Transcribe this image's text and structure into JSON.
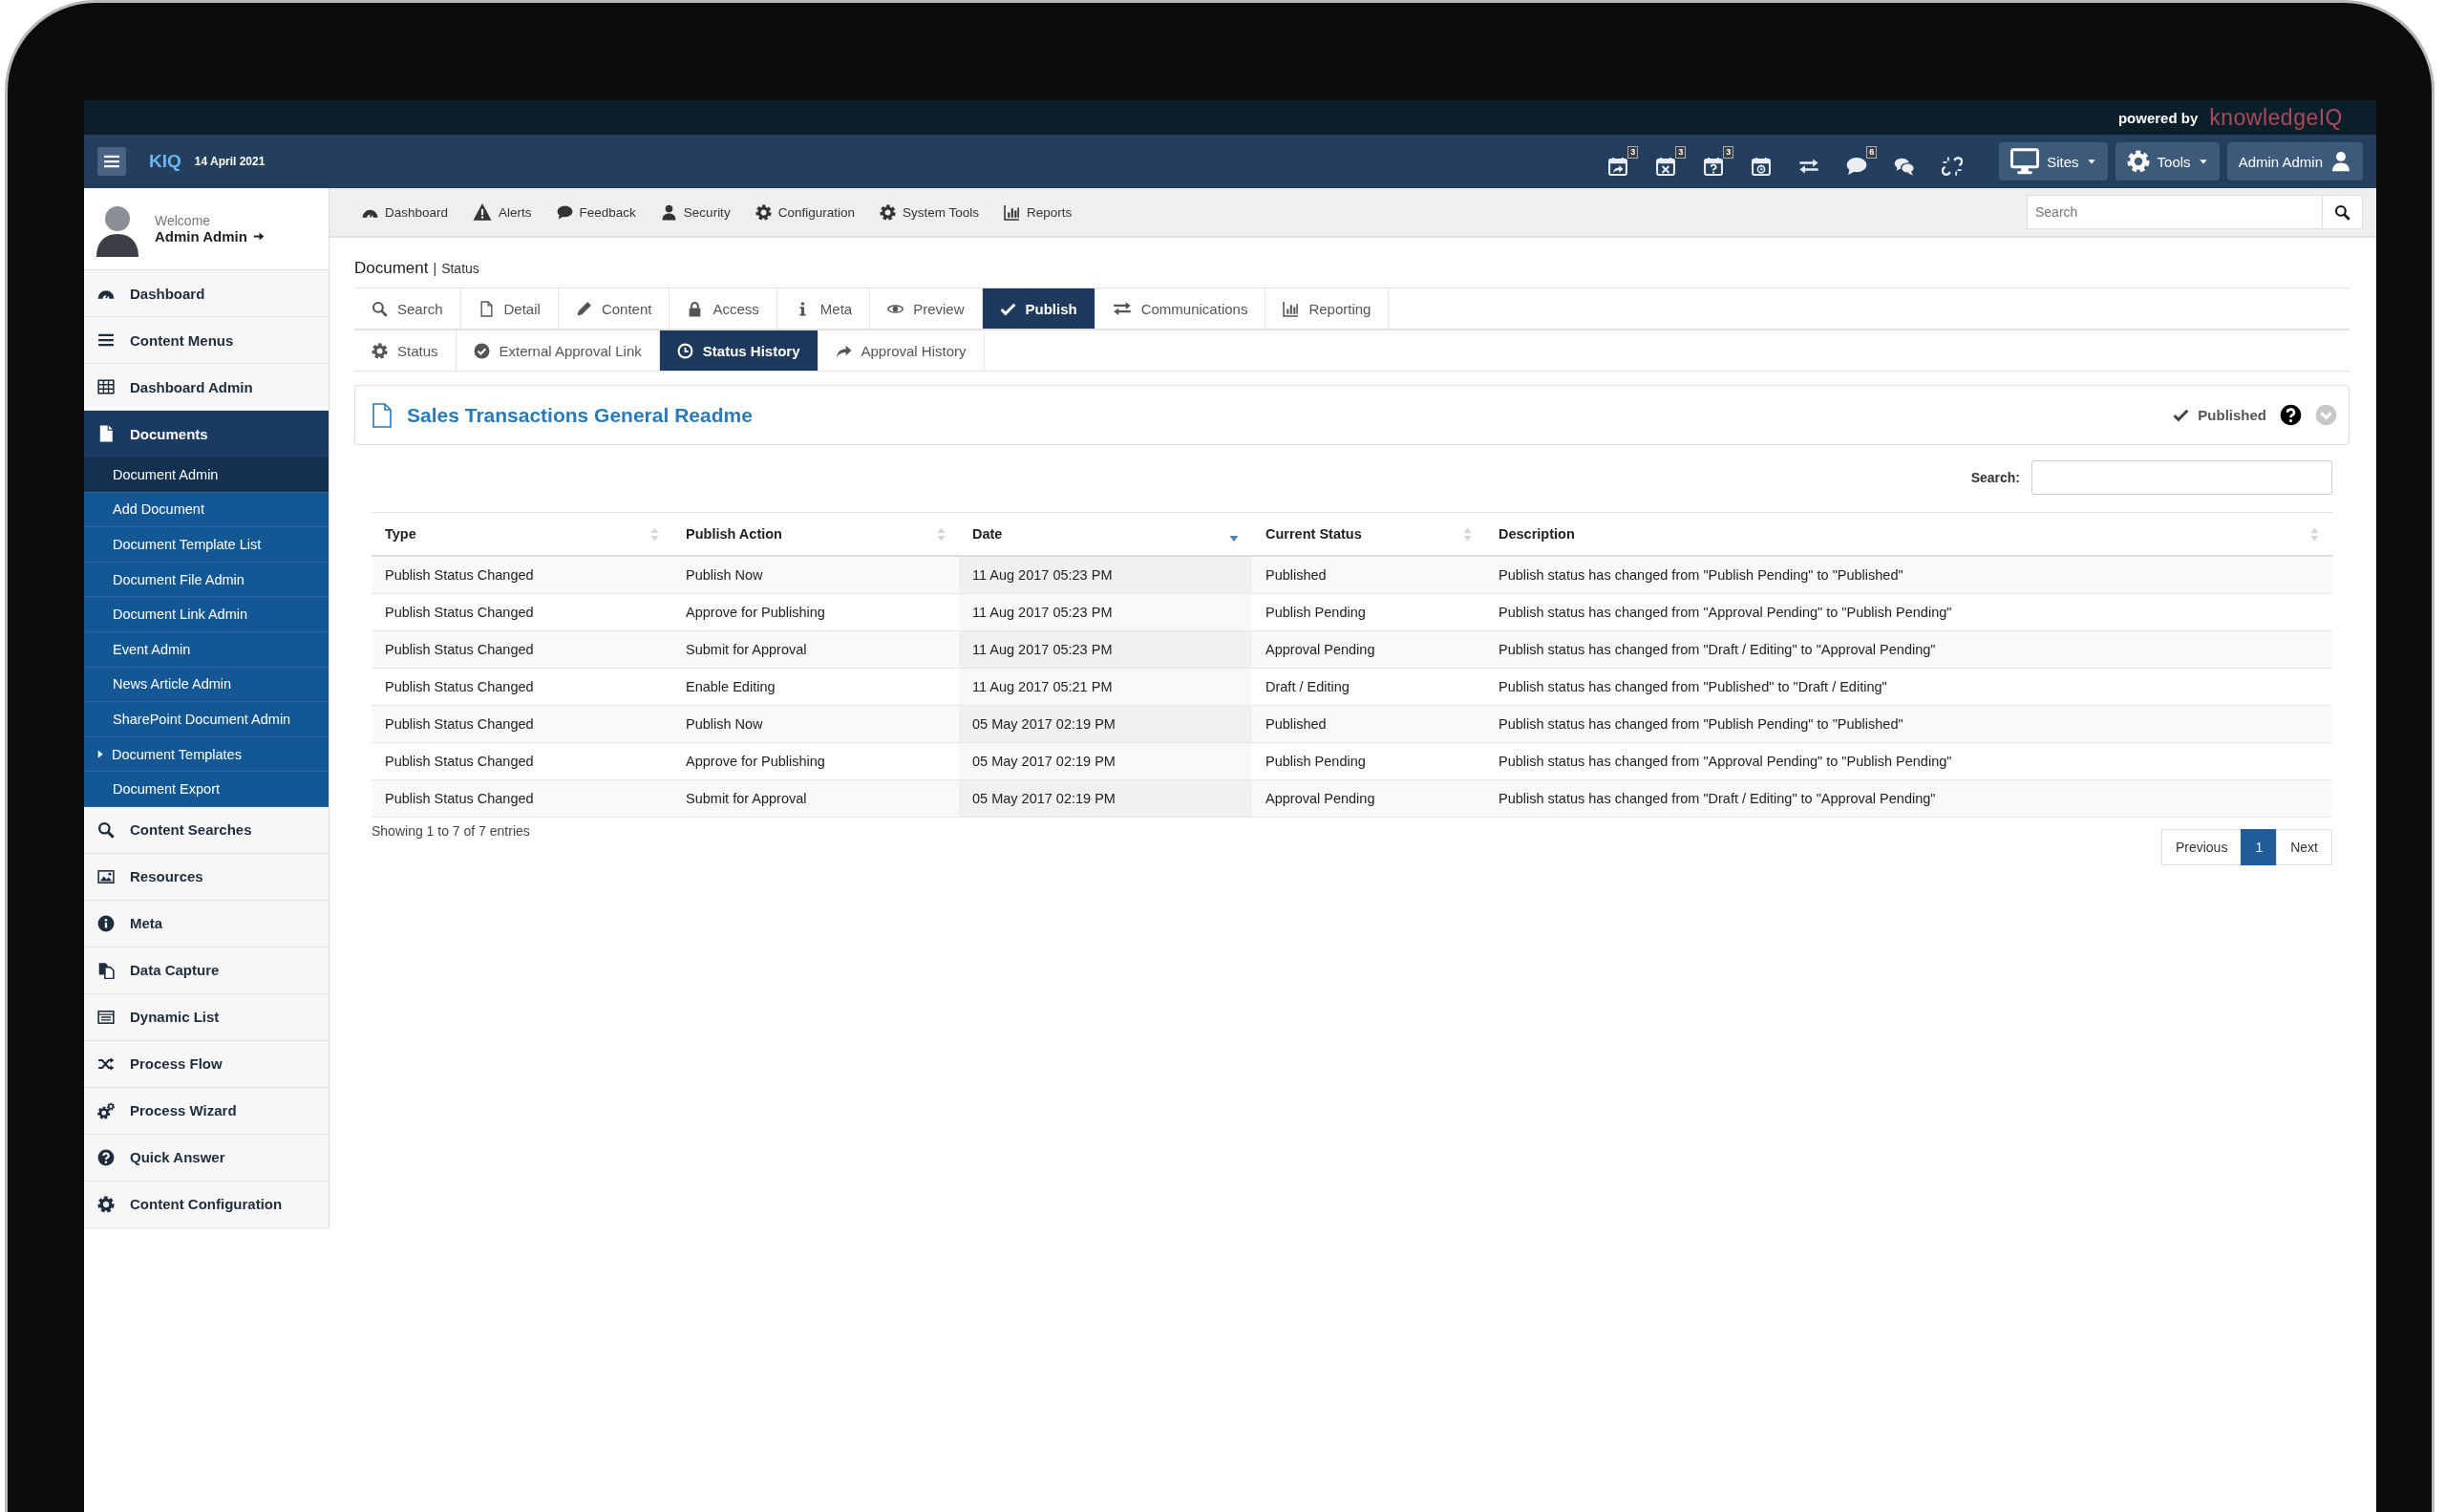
{
  "top_bar": {
    "powered_by": "powered by",
    "brand": "knowledgeIQ"
  },
  "navbar": {
    "app_name": "KIQ",
    "date": "14 April 2021",
    "icons": [
      {
        "kind": "calendar-share",
        "badge": "3"
      },
      {
        "kind": "calendar-x",
        "badge": "3"
      },
      {
        "kind": "calendar-question",
        "badge": "3"
      },
      {
        "kind": "calendar-clock"
      },
      {
        "kind": "exchange"
      },
      {
        "kind": "comment",
        "badge": "6"
      },
      {
        "kind": "comments"
      },
      {
        "kind": "unlink"
      }
    ],
    "buttons": [
      {
        "label": "Sites",
        "kind": "monitor",
        "dropdown": true
      },
      {
        "label": "Tools",
        "kind": "gear",
        "dropdown": true
      },
      {
        "label": "Admin Admin",
        "kind": "user",
        "dropdown": false
      }
    ]
  },
  "sidebar": {
    "welcome": "Welcome",
    "user": "Admin Admin",
    "items": [
      {
        "label": "Dashboard",
        "kind": "gauge",
        "selected": false
      },
      {
        "label": "Content Menus",
        "kind": "bars",
        "selected": false
      },
      {
        "label": "Dashboard Admin",
        "kind": "table",
        "selected": false
      },
      {
        "label": "Documents",
        "kind": "file",
        "selected": true,
        "children": [
          {
            "label": "Document Admin",
            "selected": true,
            "has_children": false
          },
          {
            "label": "Add Document",
            "selected": false,
            "has_children": false
          },
          {
            "label": "Document Template List",
            "selected": false,
            "has_children": false
          },
          {
            "label": "Document File Admin",
            "selected": false,
            "has_children": false
          },
          {
            "label": "Document Link Admin",
            "selected": false,
            "has_children": false
          },
          {
            "label": "Event Admin",
            "selected": false,
            "has_children": false
          },
          {
            "label": "News Article Admin",
            "selected": false,
            "has_children": false
          },
          {
            "label": "SharePoint Document Admin",
            "selected": false,
            "has_children": false
          },
          {
            "label": "Document Templates",
            "selected": false,
            "has_children": true
          },
          {
            "label": "Document Export",
            "selected": false,
            "has_children": false
          }
        ]
      },
      {
        "label": "Content Searches",
        "kind": "search",
        "selected": false
      },
      {
        "label": "Resources",
        "kind": "image",
        "selected": false
      },
      {
        "label": "Meta",
        "kind": "info",
        "selected": false
      },
      {
        "label": "Data Capture",
        "kind": "copy",
        "selected": false
      },
      {
        "label": "Dynamic List",
        "kind": "list",
        "selected": false
      },
      {
        "label": "Process Flow",
        "kind": "shuffle",
        "selected": false
      },
      {
        "label": "Process Wizard",
        "kind": "cogs",
        "selected": false
      },
      {
        "label": "Quick Answer",
        "kind": "question",
        "selected": false
      },
      {
        "label": "Content Configuration",
        "kind": "gear",
        "selected": false
      }
    ]
  },
  "toolbar": {
    "items": [
      {
        "label": "Dashboard",
        "kind": "gauge"
      },
      {
        "label": "Alerts",
        "kind": "warning"
      },
      {
        "label": "Feedback",
        "kind": "comment"
      },
      {
        "label": "Security",
        "kind": "user"
      },
      {
        "label": "Configuration",
        "kind": "gear"
      },
      {
        "label": "System Tools",
        "kind": "gear"
      },
      {
        "label": "Reports",
        "kind": "chart"
      }
    ],
    "search": {
      "placeholder": "Search"
    }
  },
  "breadcrumb": {
    "section": "Document",
    "separator": "|",
    "page": "Status"
  },
  "tabs": [
    {
      "label": "Search",
      "kind": "search",
      "selected": false
    },
    {
      "label": "Detail",
      "kind": "file-outline",
      "selected": false
    },
    {
      "label": "Content",
      "kind": "pencil",
      "selected": false
    },
    {
      "label": "Access",
      "kind": "lock",
      "selected": false
    },
    {
      "label": "Meta",
      "kind": "info-i",
      "selected": false
    },
    {
      "label": "Preview",
      "kind": "eye",
      "selected": false
    },
    {
      "label": "Publish",
      "kind": "check",
      "selected": true
    },
    {
      "label": "Communications",
      "kind": "exchange",
      "selected": false
    },
    {
      "label": "Reporting",
      "kind": "chart",
      "selected": false
    }
  ],
  "subtabs": [
    {
      "label": "Status",
      "kind": "gear",
      "selected": false
    },
    {
      "label": "External Approval Link",
      "kind": "check-circle",
      "selected": false
    },
    {
      "label": "Status History",
      "kind": "clock",
      "selected": true
    },
    {
      "label": "Approval History",
      "kind": "share",
      "selected": false
    }
  ],
  "document": {
    "title": "Sales Transactions General Readme",
    "status": "Published"
  },
  "table": {
    "search_label": "Search:",
    "columns": [
      {
        "label": "Type",
        "sorted": false
      },
      {
        "label": "Publish Action",
        "sorted": false
      },
      {
        "label": "Date",
        "sorted": true
      },
      {
        "label": "Current Status",
        "sorted": false
      },
      {
        "label": "Description",
        "sorted": false
      }
    ],
    "rows": [
      [
        "Publish Status Changed",
        "Publish Now",
        "11 Aug 2017 05:23 PM",
        "Published",
        "Publish status has changed from \"Publish Pending\" to \"Published\""
      ],
      [
        "Publish Status Changed",
        "Approve for Publishing",
        "11 Aug 2017 05:23 PM",
        "Publish Pending",
        "Publish status has changed from \"Approval Pending\" to \"Publish Pending\""
      ],
      [
        "Publish Status Changed",
        "Submit for Approval",
        "11 Aug 2017 05:23 PM",
        "Approval Pending",
        "Publish status has changed from \"Draft / Editing\" to \"Approval Pending\""
      ],
      [
        "Publish Status Changed",
        "Enable Editing",
        "11 Aug 2017 05:21 PM",
        "Draft / Editing",
        "Publish status has changed from \"Published\" to \"Draft / Editing\""
      ],
      [
        "Publish Status Changed",
        "Publish Now",
        "05 May 2017 02:19 PM",
        "Published",
        "Publish status has changed from \"Publish Pending\" to \"Published\""
      ],
      [
        "Publish Status Changed",
        "Approve for Publishing",
        "05 May 2017 02:19 PM",
        "Publish Pending",
        "Publish status has changed from \"Approval Pending\" to \"Publish Pending\""
      ],
      [
        "Publish Status Changed",
        "Submit for Approval",
        "05 May 2017 02:19 PM",
        "Approval Pending",
        "Publish status has changed from \"Draft / Editing\" to \"Approval Pending\""
      ]
    ],
    "info": "Showing 1 to 7 of 7 entries",
    "pagination": [
      {
        "label": "Previous",
        "selected": false
      },
      {
        "label": "1",
        "selected": true
      },
      {
        "label": "Next",
        "selected": false
      }
    ]
  }
}
